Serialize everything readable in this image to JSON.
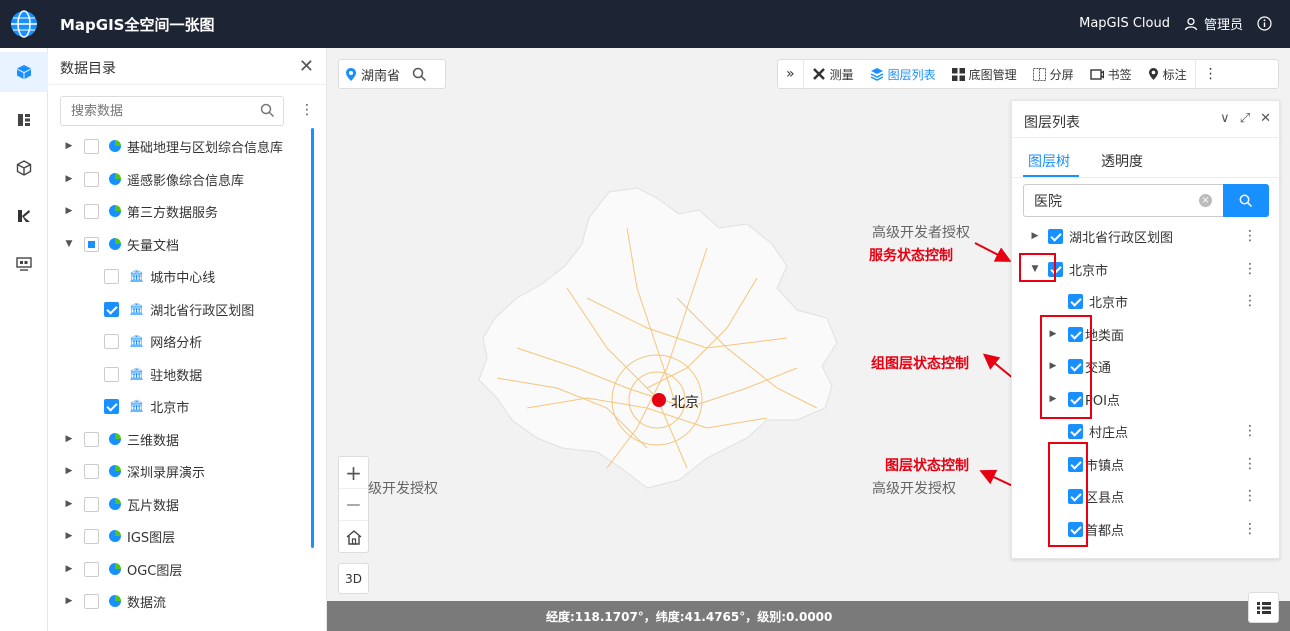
{
  "header": {
    "app_title": "MapGIS全空间一张图",
    "cloud_label": "MapGIS Cloud",
    "user_label": "管理员"
  },
  "catalog": {
    "title": "数据目录",
    "search_placeholder": "搜索数据",
    "items": [
      {
        "label": "基础地理与区划综合信息库"
      },
      {
        "label": "遥感影像综合信息库"
      },
      {
        "label": "第三方数据服务"
      },
      {
        "label": "矢量文档"
      },
      {
        "label": "城市中心线"
      },
      {
        "label": "湖北省行政区划图"
      },
      {
        "label": "网络分析"
      },
      {
        "label": "驻地数据"
      },
      {
        "label": "北京市"
      },
      {
        "label": "三维数据"
      },
      {
        "label": "深圳录屏演示"
      },
      {
        "label": "瓦片数据"
      },
      {
        "label": "IGS图层"
      },
      {
        "label": "OGC图层"
      },
      {
        "label": "数据流"
      }
    ]
  },
  "location": {
    "label": "湖南省"
  },
  "toolbar": {
    "measure": "测量",
    "layers": "图层列表",
    "basemap": "底图管理",
    "split": "分屏",
    "bookmark": "书签",
    "mark": "标注"
  },
  "map": {
    "city_label": "北京",
    "watermark": "高级开发授权",
    "watermark_left": "级开发授权",
    "watermark_top": "高级开发者授权",
    "watermark_right": "高级开发者授权",
    "zoom_in": "+",
    "zoom_out": "—",
    "btn_3d": "3D"
  },
  "annotations": {
    "service": "服务状态控制",
    "group": "组图层状态控制",
    "layer": "图层状态控制"
  },
  "layer_panel": {
    "title": "图层列表",
    "tab_tree": "图层树",
    "tab_opacity": "透明度",
    "search_value": "医院",
    "rows": [
      {
        "label": "湖北省行政区划图"
      },
      {
        "label": "北京市"
      },
      {
        "label": "北京市"
      },
      {
        "label": "地类面"
      },
      {
        "label": "交通"
      },
      {
        "label": "POI点"
      },
      {
        "label": "村庄点"
      },
      {
        "label": "市镇点"
      },
      {
        "label": "区县点"
      },
      {
        "label": "首都点"
      }
    ]
  },
  "statusbar": {
    "text": "经度:118.1707°，纬度:41.4765°，级别:0.0000"
  }
}
